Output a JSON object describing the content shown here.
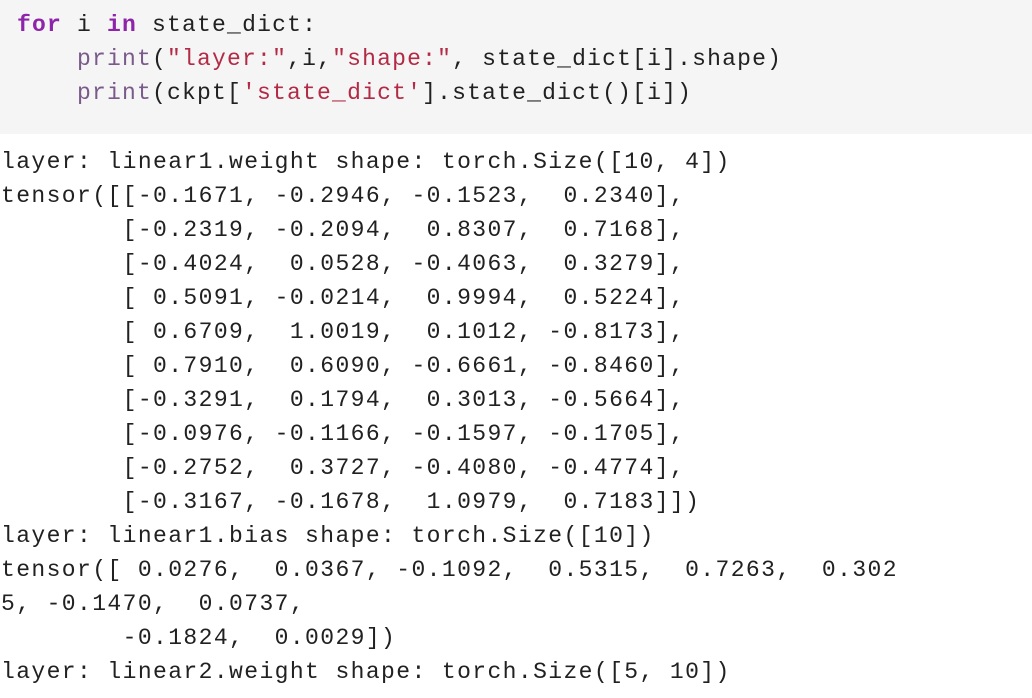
{
  "code": {
    "line1": {
      "kw_for": "for",
      "var_i": " i ",
      "kw_in": "in",
      "rest": " state_dict:"
    },
    "line2": {
      "indent": "    ",
      "fn": "print",
      "open": "(",
      "s1": "\"layer:\"",
      "mid": ",i,",
      "s2": "\"shape:\"",
      "rest": ", state_dict[i].shape)"
    },
    "line3": {
      "indent": "    ",
      "fn": "print",
      "open": "(ckpt[",
      "s1": "'state_dict'",
      "rest": "].state_dict()[i])"
    }
  },
  "output_lines": [
    "layer: linear1.weight shape: torch.Size([10, 4])",
    "tensor([[-0.1671, -0.2946, -0.1523,  0.2340],",
    "        [-0.2319, -0.2094,  0.8307,  0.7168],",
    "        [-0.4024,  0.0528, -0.4063,  0.3279],",
    "        [ 0.5091, -0.0214,  0.9994,  0.5224],",
    "        [ 0.6709,  1.0019,  0.1012, -0.8173],",
    "        [ 0.7910,  0.6090, -0.6661, -0.8460],",
    "        [-0.3291,  0.1794,  0.3013, -0.5664],",
    "        [-0.0976, -0.1166, -0.1597, -0.1705],",
    "        [-0.2752,  0.3727, -0.4080, -0.4774],",
    "        [-0.3167, -0.1678,  1.0979,  0.7183]])",
    "layer: linear1.bias shape: torch.Size([10])",
    "tensor([ 0.0276,  0.0367, -0.1092,  0.5315,  0.7263,  0.302",
    "5, -0.1470,  0.0737,",
    "        -0.1824,  0.0029])",
    "layer: linear2.weight shape: torch.Size([5, 10])"
  ],
  "colors": {
    "keyword": "#8e24aa",
    "builtin": "#7a5a8a",
    "string": "#b22a45",
    "text": "#212121",
    "code_background": "#f5f5f5",
    "output_background": "#ffffff"
  }
}
